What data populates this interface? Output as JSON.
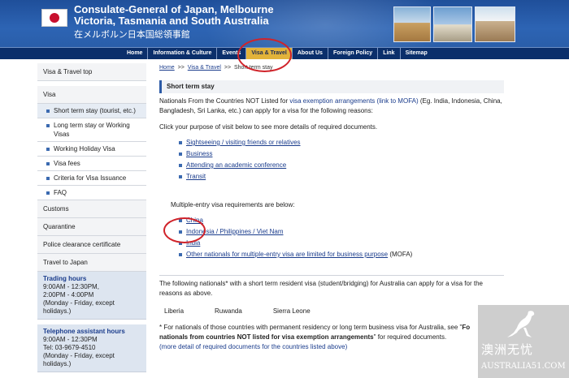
{
  "header": {
    "title_line1": "Consulate-General of Japan, Melbourne",
    "title_line2": "Victoria, Tasmania and South Australia",
    "subtitle": "在メルボルン日本国総領事館"
  },
  "nav": {
    "items": [
      "Home",
      "Information & Culture",
      "Events",
      "Visa & Travel",
      "About Us",
      "Foreign Policy",
      "Link",
      "Sitemap"
    ],
    "active": "Visa & Travel"
  },
  "sidebar": {
    "top": "Visa & Travel top",
    "visa": "Visa",
    "sub": [
      "Short term stay (tourist, etc.)",
      "Long term stay or Working Visas",
      "Working Holiday Visa",
      "Visa fees",
      "Criteria for Visa Issuance",
      "FAQ"
    ],
    "items": [
      "Customs",
      "Quarantine",
      "Police clearance certificate",
      "Travel to Japan"
    ],
    "trading": {
      "title": "Trading hours",
      "lines": [
        "9:00AM - 12:30PM,",
        "2:00PM - 4:00PM",
        "(Monday - Friday, except",
        "holidays.)"
      ]
    },
    "telephone": {
      "title": "Telephone assistant hours",
      "lines": [
        "9:00AM - 12:30PM",
        "Tel: 03-9679-4510",
        "(Monday - Friday, except",
        "holidays.)"
      ]
    }
  },
  "breadcrumb": {
    "home": "Home",
    "sep": ">>",
    "visa_travel": "Visa & Travel",
    "current": "Short term stay"
  },
  "main": {
    "heading": "Short term stay",
    "intro_pre": "Nationals From the Countries NOT Listed for ",
    "intro_link": "visa exemption arrangements (link to MOFA)",
    "intro_post": " (Eg. India, Indonesia, China, Bangladesh, Sri Lanka, etc.) can apply for a visa for the following reasons:",
    "click_text": "Click your purpose of visit below to see more details of required documents.",
    "purposes": [
      "Sightseeing / visiting friends or relatives",
      "Business",
      "Attending an academic conference",
      "Transit"
    ],
    "multi_heading": "Multiple-entry visa requirements are below:",
    "multi": [
      "China",
      "Indonesia / Philippines / Viet Nam",
      "India",
      "Other nationals for multiple-entry visa are limited for business purpose"
    ],
    "multi_suffix": " (MOFA)",
    "following_text": "The following nationals* with a short term resident visa (student/bridging) for Australia can apply for a visa for the reasons as above.",
    "nations": [
      "Liberia",
      "Ruwanda",
      "Sierra Leone"
    ],
    "note_pre": "* For nationals of those countries with permanent residency or long term business visa for Australia, see \"",
    "note_bold": "Fo",
    "note_line2_bold": "nationals from countries NOT listed for visa exemption arrangements",
    "note_post": "\" for required documents.",
    "more_link": "(more detail of required documents for the countries listed above)"
  },
  "watermark": {
    "cn": "澳洲无忧",
    "en": "AUSTRALIA51.COM"
  },
  "colors": {
    "header_blue": "#2d64b4",
    "nav_dark": "#0b2f6b",
    "nav_active": "#e2b33a",
    "link": "#1a3c8c",
    "annotation_red": "#d0232a"
  }
}
